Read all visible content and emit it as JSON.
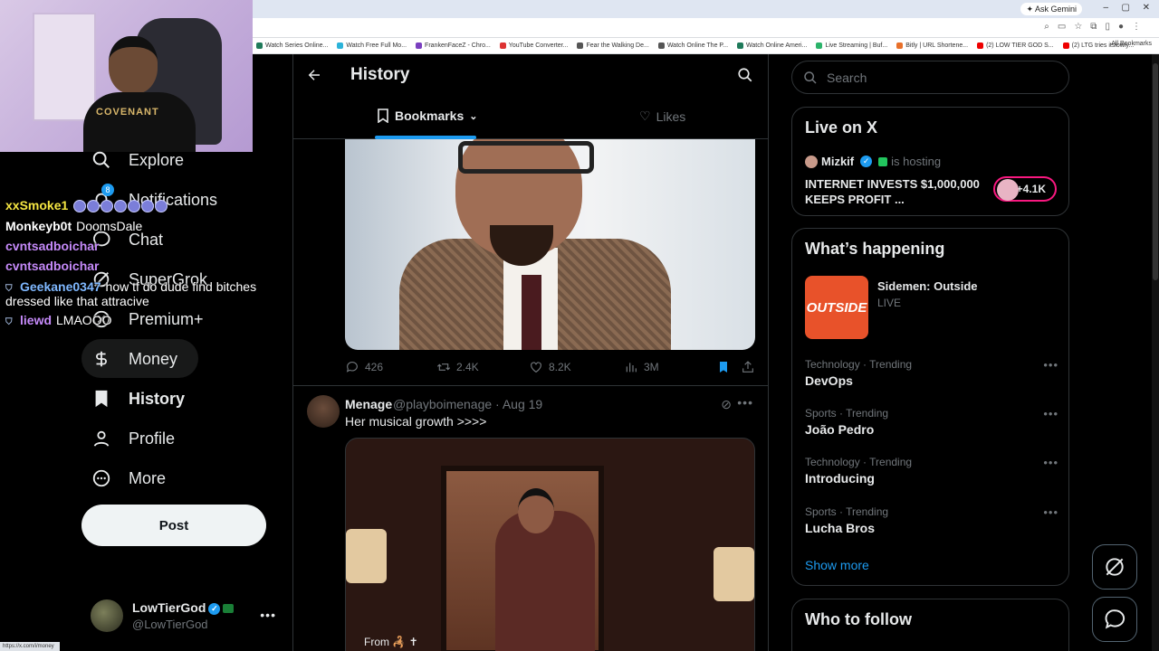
{
  "browser": {
    "ask_gemini": "✦ Ask Gemini",
    "bookmarks": [
      {
        "label": "Watch Series Online...",
        "color": "#1f7a5a"
      },
      {
        "label": "Watch Free Full Mo...",
        "color": "#2bb3d9"
      },
      {
        "label": "FrankenFaceZ - Chro...",
        "color": "#7a3fbf"
      },
      {
        "label": "YouTube Converter...",
        "color": "#d33"
      },
      {
        "label": "Fear the Walking De...",
        "color": "#555"
      },
      {
        "label": "Watch Online The P...",
        "color": "#555"
      },
      {
        "label": "Watch Online Ameri...",
        "color": "#1f7a5a"
      },
      {
        "label": "Live Streaming | Buf...",
        "color": "#2bb36a"
      },
      {
        "label": "Bitly | URL Shortene...",
        "color": "#e8702a"
      },
      {
        "label": "(2) LOW TIER GOD S...",
        "color": "#e00"
      },
      {
        "label": "(2) LTG tries itslowly...",
        "color": "#e00"
      }
    ],
    "all_bookmarks": "All Bookmarks",
    "status_url": "https://x.com/i/money"
  },
  "webcam": {
    "shirt_text": "COVENANT"
  },
  "nav": {
    "items": [
      {
        "label": "Explore",
        "icon": "search-icon"
      },
      {
        "label": "Notifications",
        "icon": "bell-icon",
        "badge": "8"
      },
      {
        "label": "Chat",
        "icon": "chat-icon"
      },
      {
        "label": "SuperGrok",
        "icon": "grok-icon"
      },
      {
        "label": "Premium+",
        "icon": "x-circle-icon"
      },
      {
        "label": "Money",
        "icon": "dollar-icon"
      },
      {
        "label": "History",
        "icon": "bookmark-icon"
      },
      {
        "label": "Profile",
        "icon": "person-icon"
      },
      {
        "label": "More",
        "icon": "more-circle-icon"
      }
    ],
    "post_label": "Post",
    "account": {
      "name": "LowTierGod",
      "handle": "@LowTierGod"
    }
  },
  "chat": [
    {
      "user": "xxSmoke1",
      "color": "#f5e642",
      "msg": ""
    },
    {
      "user": "Monkeyb0t",
      "color": "#ffffff",
      "msg": "DoomsDale"
    },
    {
      "user": "cvntsadboichar",
      "color": "#c58af9",
      "msg": ""
    },
    {
      "user": "cvntsadboichar",
      "color": "#c58af9",
      "msg": ""
    },
    {
      "user": "Geekane0347",
      "color": "#7fb8ff",
      "msg": "how tf do dude find bitches",
      "cont": "dressed like that attracive"
    },
    {
      "user": "liewd",
      "color": "#c58af9",
      "msg": "LMAOOO"
    }
  ],
  "center": {
    "title": "History",
    "tab_bookmarks": "Bookmarks",
    "tab_likes": "Likes",
    "post1": {
      "replies": "426",
      "reposts": "2.4K",
      "likes": "8.2K",
      "views": "3M"
    },
    "post2": {
      "name": "Menage",
      "handle_time": "@playboimenage · Aug 19",
      "text": "Her musical growth >>>>",
      "media_caption": "From 🦂 ✝"
    }
  },
  "right": {
    "search_placeholder": "Search",
    "live": {
      "title": "Live on X",
      "host": "Mizkif",
      "hosting": "is hosting",
      "space_title": "INTERNET INVESTS $1,000,000 KEEPS PROFIT ...",
      "count": "+4.1K"
    },
    "happening": {
      "title": "What’s happening",
      "featured": {
        "title": "Sidemen: Outside",
        "sub": "LIVE",
        "thumb": "OUTSIDE"
      },
      "trends": [
        {
          "cat": "Technology · Trending",
          "name": "DevOps"
        },
        {
          "cat": "Sports · Trending",
          "name": "João Pedro"
        },
        {
          "cat": "Technology · Trending",
          "name": "Introducing"
        },
        {
          "cat": "Sports · Trending",
          "name": "Lucha Bros"
        }
      ],
      "show_more": "Show more"
    },
    "who_to_follow": "Who to follow"
  },
  "colors": {
    "accent": "#1d9bf0",
    "live_ring": "#f91880"
  }
}
